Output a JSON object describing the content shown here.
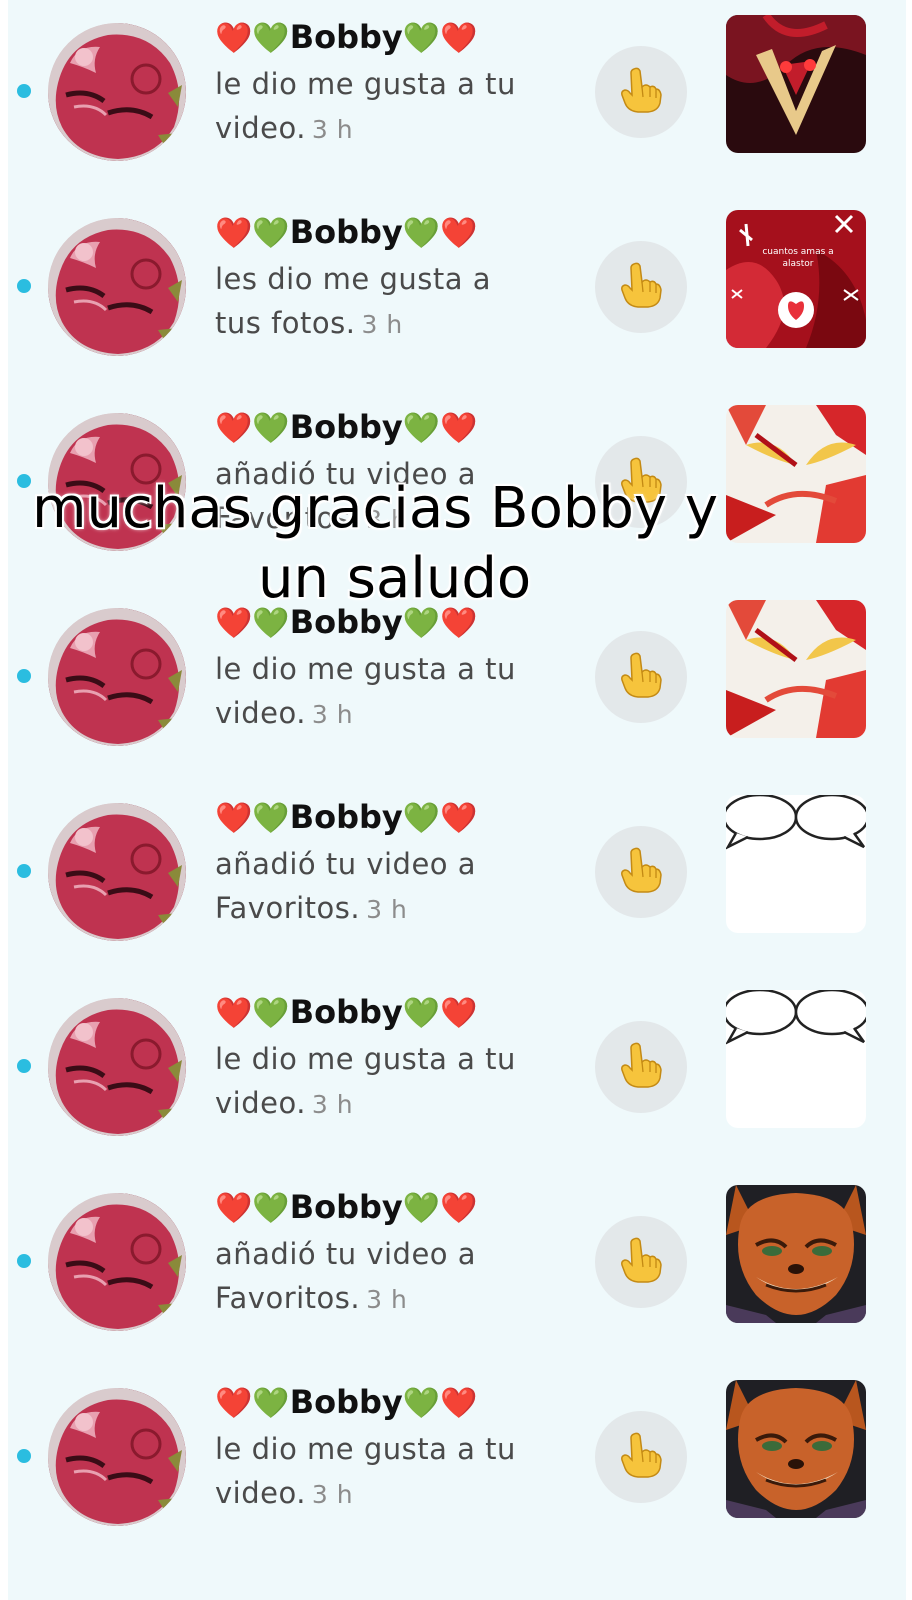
{
  "accent_color": "#2bbde0",
  "background_color": "#eff9fb",
  "notifications": [
    {
      "name": "❤️💚Bobby💚❤️",
      "message": "le dio me gusta a tu video.",
      "time": "3 h",
      "thumbnail": "red-character-closeup",
      "unread": true
    },
    {
      "name": "❤️💚Bobby💚❤️",
      "message": "les dio me gusta a tus fotos.",
      "time": "3 h",
      "thumbnail": "red-character-photo",
      "unread": true
    },
    {
      "name": "❤️💚Bobby💚❤️",
      "message": "añadió tu video a Favoritos.",
      "time": "3 h",
      "thumbnail": "red-white-eyes",
      "unread": true
    },
    {
      "name": "❤️💚Bobby💚❤️",
      "message": "le dio me gusta a tu video.",
      "time": "3 h",
      "thumbnail": "red-white-eyes",
      "unread": true
    },
    {
      "name": "❤️💚Bobby💚❤️",
      "message": "añadió tu video a Favoritos.",
      "time": "3 h",
      "thumbnail": "speech-bubbles",
      "unread": true
    },
    {
      "name": "❤️💚Bobby💚❤️",
      "message": "le dio me gusta a tu video.",
      "time": "3 h",
      "thumbnail": "speech-bubbles",
      "unread": true
    },
    {
      "name": "❤️💚Bobby💚❤️",
      "message": "añadió tu video a Favoritos.",
      "time": "3 h",
      "thumbnail": "fox-character",
      "unread": true
    },
    {
      "name": "❤️💚Bobby💚❤️",
      "message": "le dio me gusta a tu video.",
      "time": "3 h",
      "thumbnail": "fox-character",
      "unread": true
    }
  ],
  "like_icon": "pointing-hand-icon",
  "thumbnail_text": "cuantos amas a alastor",
  "overlay": {
    "line1": "muchas gracias Bobby y",
    "line2": "un saludo"
  }
}
